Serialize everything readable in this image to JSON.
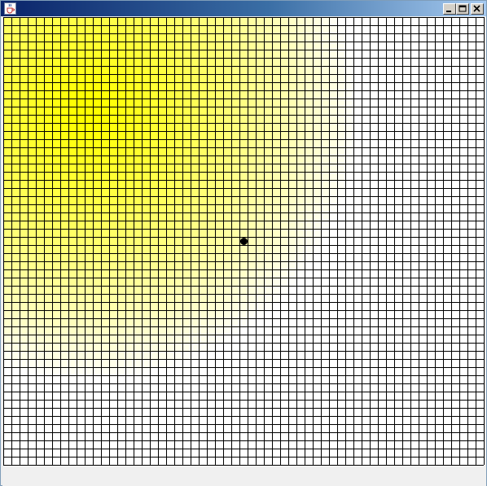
{
  "window": {
    "title": ""
  },
  "titlebar": {
    "icon": "java-cup-icon",
    "buttons": [
      "minimize-icon",
      "maximize-icon",
      "close-icon"
    ],
    "gradient_start": "#0a246a",
    "gradient_end": "#a6caf0"
  },
  "grid": {
    "columns": 59,
    "rows": 55,
    "line_color": "#000000",
    "background_color": "#ffffff",
    "highlight_color": "#ffff00",
    "highlight_center_cell": [
      10,
      11
    ],
    "highlight_radius_cells": 33,
    "agent_cell": [
      29,
      27
    ],
    "agent_color": "#000000"
  }
}
